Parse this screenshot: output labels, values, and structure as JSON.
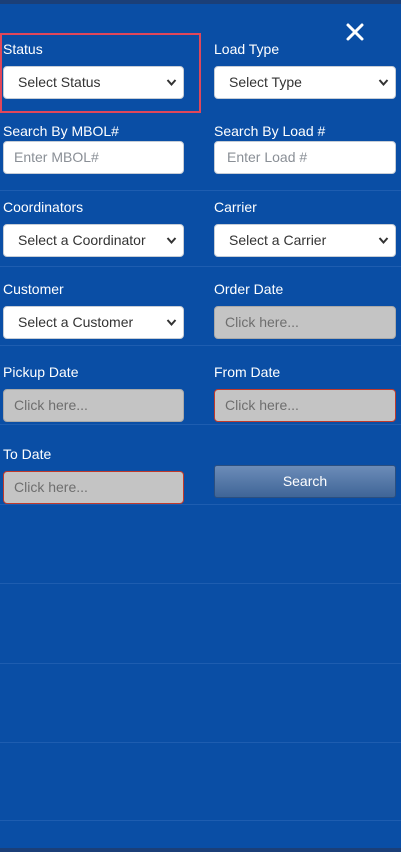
{
  "close_label": "×",
  "status": {
    "label": "Status",
    "value": "Select Status"
  },
  "load_type": {
    "label": "Load Type",
    "value": "Select Type"
  },
  "mbol": {
    "label": "Search By MBOL#",
    "placeholder": "Enter MBOL#"
  },
  "load_no": {
    "label": "Search By Load #",
    "placeholder": "Enter Load #"
  },
  "coordinators": {
    "label": "Coordinators",
    "value": "Select a Coordinator"
  },
  "carrier": {
    "label": "Carrier",
    "value": "Select a Carrier"
  },
  "customer": {
    "label": "Customer",
    "value": "Select a Customer"
  },
  "order_date": {
    "label": "Order Date",
    "placeholder": "Click here..."
  },
  "pickup_date": {
    "label": "Pickup Date",
    "placeholder": "Click here..."
  },
  "from_date": {
    "label": "From Date",
    "placeholder": "Click here..."
  },
  "to_date": {
    "label": "To Date",
    "placeholder": "Click here..."
  },
  "search_button": "Search",
  "colors": {
    "panel_bg": "#0a4ea5",
    "highlight": "#e0475a",
    "date_bg": "#c4c4c4",
    "error_border": "#c0392b"
  }
}
